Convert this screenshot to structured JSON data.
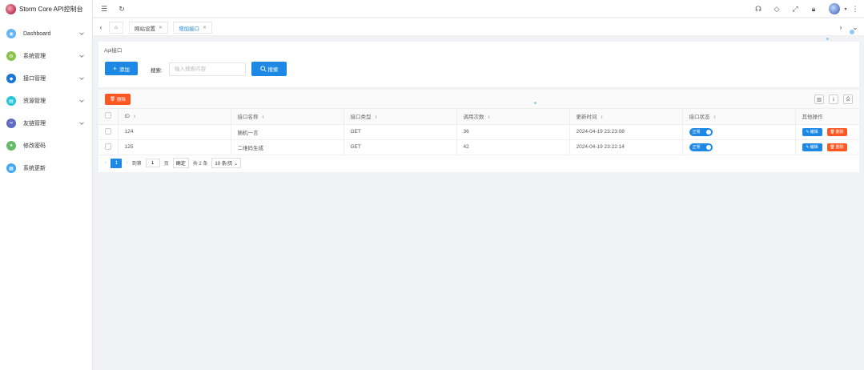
{
  "app": {
    "title": "Storm Core API控制台"
  },
  "sidebar": {
    "items": [
      {
        "label": "Dashboard",
        "icon": "dashboard-icon",
        "color": "#64b5f6",
        "has_children": true
      },
      {
        "label": "系统管理",
        "icon": "system-icon",
        "color": "#8bc34a",
        "has_children": true
      },
      {
        "label": "接口管理",
        "icon": "api-icon",
        "color": "#1976d2",
        "has_children": true
      },
      {
        "label": "资源管理",
        "icon": "resource-icon",
        "color": "#26c6da",
        "has_children": true
      },
      {
        "label": "友链管理",
        "icon": "link-icon",
        "color": "#5c6bc0",
        "has_children": true
      },
      {
        "label": "修改密码",
        "icon": "password-icon",
        "color": "#66bb6a",
        "has_children": false
      },
      {
        "label": "系统更新",
        "icon": "update-icon",
        "color": "#42a5f5",
        "has_children": false
      }
    ]
  },
  "tabs": [
    {
      "label": "网站设置",
      "active": false
    },
    {
      "label": "增加接口",
      "active": true
    }
  ],
  "panel": {
    "breadcrumb": "Api接口",
    "add_label": "添加",
    "search_label": "搜索:",
    "search_placeholder": "输入搜索内容",
    "search_button": "搜索",
    "delete_label": "删除"
  },
  "table": {
    "headers": [
      "ID",
      "接口名称",
      "接口类型",
      "调用次数",
      "更新时间",
      "接口状态",
      "其他操作"
    ],
    "rows": [
      {
        "id": "124",
        "name": "随机一言",
        "type": "GET",
        "calls": "36",
        "updated": "2024-04-19 23:23:08",
        "status": "正常",
        "edit": "编辑",
        "delete": "删除"
      },
      {
        "id": "125",
        "name": "二维码生成",
        "type": "GET",
        "calls": "42",
        "updated": "2024-04-19 23:22:14",
        "status": "正常",
        "edit": "编辑",
        "delete": "删除"
      }
    ]
  },
  "pagination": {
    "current_page": "1",
    "goto_label": "到第",
    "goto_value": "1",
    "page_unit": "页",
    "confirm": "确定",
    "total": "共 2 条",
    "page_size": "10 条/页"
  },
  "colors": {
    "primary": "#1e88e5",
    "danger": "#ff5722"
  }
}
